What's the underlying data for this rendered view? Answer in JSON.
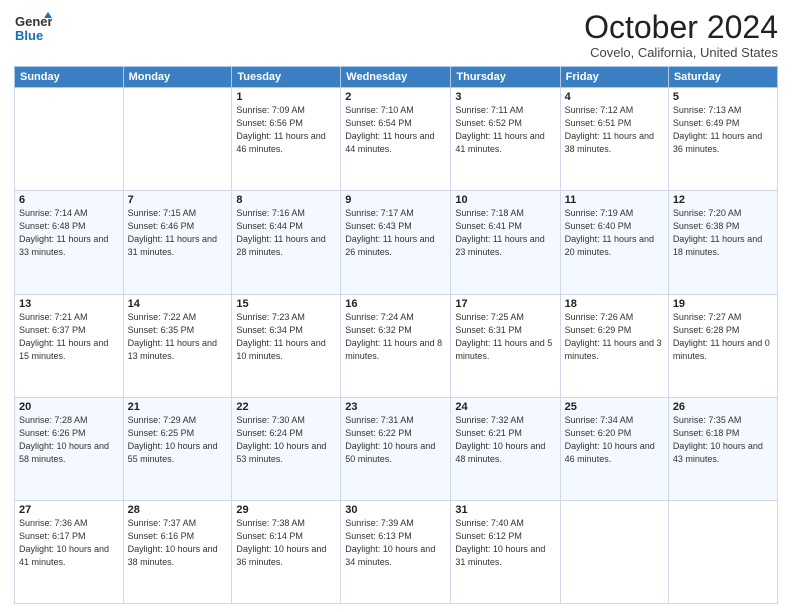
{
  "logo": {
    "line1": "General",
    "line2": "Blue"
  },
  "title": "October 2024",
  "subtitle": "Covelo, California, United States",
  "weekdays": [
    "Sunday",
    "Monday",
    "Tuesday",
    "Wednesday",
    "Thursday",
    "Friday",
    "Saturday"
  ],
  "weeks": [
    [
      {
        "day": "",
        "sunrise": "",
        "sunset": "",
        "daylight": ""
      },
      {
        "day": "",
        "sunrise": "",
        "sunset": "",
        "daylight": ""
      },
      {
        "day": "1",
        "sunrise": "Sunrise: 7:09 AM",
        "sunset": "Sunset: 6:56 PM",
        "daylight": "Daylight: 11 hours and 46 minutes."
      },
      {
        "day": "2",
        "sunrise": "Sunrise: 7:10 AM",
        "sunset": "Sunset: 6:54 PM",
        "daylight": "Daylight: 11 hours and 44 minutes."
      },
      {
        "day": "3",
        "sunrise": "Sunrise: 7:11 AM",
        "sunset": "Sunset: 6:52 PM",
        "daylight": "Daylight: 11 hours and 41 minutes."
      },
      {
        "day": "4",
        "sunrise": "Sunrise: 7:12 AM",
        "sunset": "Sunset: 6:51 PM",
        "daylight": "Daylight: 11 hours and 38 minutes."
      },
      {
        "day": "5",
        "sunrise": "Sunrise: 7:13 AM",
        "sunset": "Sunset: 6:49 PM",
        "daylight": "Daylight: 11 hours and 36 minutes."
      }
    ],
    [
      {
        "day": "6",
        "sunrise": "Sunrise: 7:14 AM",
        "sunset": "Sunset: 6:48 PM",
        "daylight": "Daylight: 11 hours and 33 minutes."
      },
      {
        "day": "7",
        "sunrise": "Sunrise: 7:15 AM",
        "sunset": "Sunset: 6:46 PM",
        "daylight": "Daylight: 11 hours and 31 minutes."
      },
      {
        "day": "8",
        "sunrise": "Sunrise: 7:16 AM",
        "sunset": "Sunset: 6:44 PM",
        "daylight": "Daylight: 11 hours and 28 minutes."
      },
      {
        "day": "9",
        "sunrise": "Sunrise: 7:17 AM",
        "sunset": "Sunset: 6:43 PM",
        "daylight": "Daylight: 11 hours and 26 minutes."
      },
      {
        "day": "10",
        "sunrise": "Sunrise: 7:18 AM",
        "sunset": "Sunset: 6:41 PM",
        "daylight": "Daylight: 11 hours and 23 minutes."
      },
      {
        "day": "11",
        "sunrise": "Sunrise: 7:19 AM",
        "sunset": "Sunset: 6:40 PM",
        "daylight": "Daylight: 11 hours and 20 minutes."
      },
      {
        "day": "12",
        "sunrise": "Sunrise: 7:20 AM",
        "sunset": "Sunset: 6:38 PM",
        "daylight": "Daylight: 11 hours and 18 minutes."
      }
    ],
    [
      {
        "day": "13",
        "sunrise": "Sunrise: 7:21 AM",
        "sunset": "Sunset: 6:37 PM",
        "daylight": "Daylight: 11 hours and 15 minutes."
      },
      {
        "day": "14",
        "sunrise": "Sunrise: 7:22 AM",
        "sunset": "Sunset: 6:35 PM",
        "daylight": "Daylight: 11 hours and 13 minutes."
      },
      {
        "day": "15",
        "sunrise": "Sunrise: 7:23 AM",
        "sunset": "Sunset: 6:34 PM",
        "daylight": "Daylight: 11 hours and 10 minutes."
      },
      {
        "day": "16",
        "sunrise": "Sunrise: 7:24 AM",
        "sunset": "Sunset: 6:32 PM",
        "daylight": "Daylight: 11 hours and 8 minutes."
      },
      {
        "day": "17",
        "sunrise": "Sunrise: 7:25 AM",
        "sunset": "Sunset: 6:31 PM",
        "daylight": "Daylight: 11 hours and 5 minutes."
      },
      {
        "day": "18",
        "sunrise": "Sunrise: 7:26 AM",
        "sunset": "Sunset: 6:29 PM",
        "daylight": "Daylight: 11 hours and 3 minutes."
      },
      {
        "day": "19",
        "sunrise": "Sunrise: 7:27 AM",
        "sunset": "Sunset: 6:28 PM",
        "daylight": "Daylight: 11 hours and 0 minutes."
      }
    ],
    [
      {
        "day": "20",
        "sunrise": "Sunrise: 7:28 AM",
        "sunset": "Sunset: 6:26 PM",
        "daylight": "Daylight: 10 hours and 58 minutes."
      },
      {
        "day": "21",
        "sunrise": "Sunrise: 7:29 AM",
        "sunset": "Sunset: 6:25 PM",
        "daylight": "Daylight: 10 hours and 55 minutes."
      },
      {
        "day": "22",
        "sunrise": "Sunrise: 7:30 AM",
        "sunset": "Sunset: 6:24 PM",
        "daylight": "Daylight: 10 hours and 53 minutes."
      },
      {
        "day": "23",
        "sunrise": "Sunrise: 7:31 AM",
        "sunset": "Sunset: 6:22 PM",
        "daylight": "Daylight: 10 hours and 50 minutes."
      },
      {
        "day": "24",
        "sunrise": "Sunrise: 7:32 AM",
        "sunset": "Sunset: 6:21 PM",
        "daylight": "Daylight: 10 hours and 48 minutes."
      },
      {
        "day": "25",
        "sunrise": "Sunrise: 7:34 AM",
        "sunset": "Sunset: 6:20 PM",
        "daylight": "Daylight: 10 hours and 46 minutes."
      },
      {
        "day": "26",
        "sunrise": "Sunrise: 7:35 AM",
        "sunset": "Sunset: 6:18 PM",
        "daylight": "Daylight: 10 hours and 43 minutes."
      }
    ],
    [
      {
        "day": "27",
        "sunrise": "Sunrise: 7:36 AM",
        "sunset": "Sunset: 6:17 PM",
        "daylight": "Daylight: 10 hours and 41 minutes."
      },
      {
        "day": "28",
        "sunrise": "Sunrise: 7:37 AM",
        "sunset": "Sunset: 6:16 PM",
        "daylight": "Daylight: 10 hours and 38 minutes."
      },
      {
        "day": "29",
        "sunrise": "Sunrise: 7:38 AM",
        "sunset": "Sunset: 6:14 PM",
        "daylight": "Daylight: 10 hours and 36 minutes."
      },
      {
        "day": "30",
        "sunrise": "Sunrise: 7:39 AM",
        "sunset": "Sunset: 6:13 PM",
        "daylight": "Daylight: 10 hours and 34 minutes."
      },
      {
        "day": "31",
        "sunrise": "Sunrise: 7:40 AM",
        "sunset": "Sunset: 6:12 PM",
        "daylight": "Daylight: 10 hours and 31 minutes."
      },
      {
        "day": "",
        "sunrise": "",
        "sunset": "",
        "daylight": ""
      },
      {
        "day": "",
        "sunrise": "",
        "sunset": "",
        "daylight": ""
      }
    ]
  ]
}
